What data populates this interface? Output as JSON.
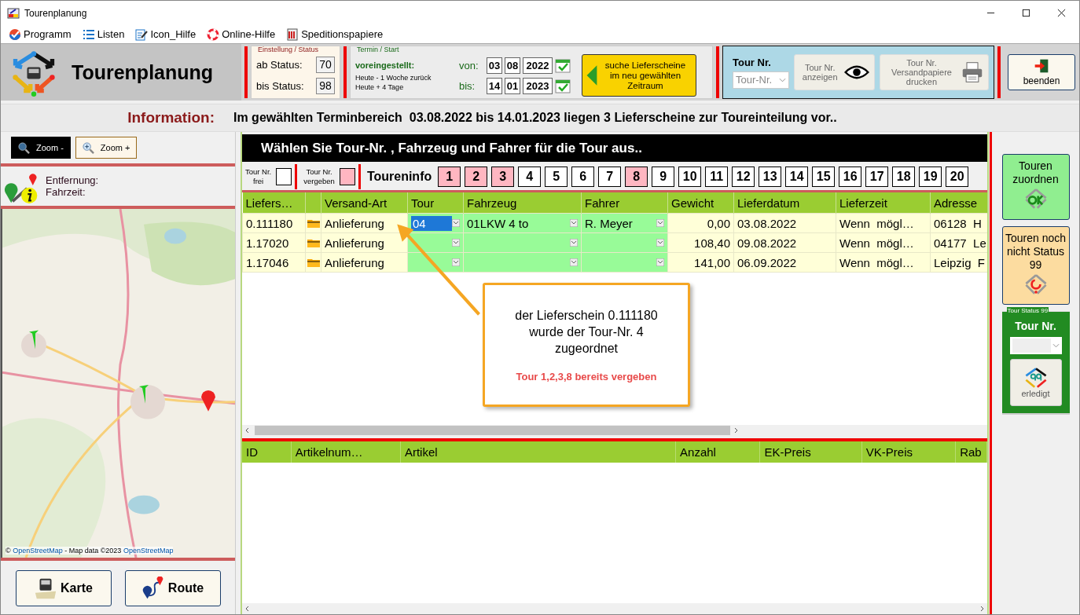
{
  "window": {
    "title": "Tourenplanung"
  },
  "menu": [
    {
      "label": "Programm"
    },
    {
      "label": "Listen"
    },
    {
      "label": "Icon_Hilfe"
    },
    {
      "label": "Online-Hilfe"
    },
    {
      "label": "Speditionspapiere"
    }
  ],
  "header": {
    "title": "Tourenplanung",
    "status": {
      "legend": "Einstellung / Status",
      "from_label": "ab Status:",
      "from_value": "70",
      "to_label": "bis Status:",
      "to_value": "98"
    },
    "termin": {
      "legend": "Termin / Start",
      "preset_label": "voreingestellt:",
      "preset_from": "Heute - 1 Woche zurück",
      "preset_to": "Heute + 4 Tage",
      "rows": [
        {
          "label": "von:",
          "day": "03",
          "month": "08",
          "year": "2022"
        },
        {
          "label": "bis:",
          "day": "14",
          "month": "01",
          "year": "2023"
        }
      ]
    },
    "search_button": [
      "suche Lieferscheine",
      "im neu gewählten",
      "Zeitraum"
    ],
    "tour_panel": {
      "label": "Tour Nr.",
      "select_placeholder": "Tour-Nr.",
      "show_button": [
        "Tour Nr.",
        "anzeigen"
      ],
      "print_button": [
        "Tour Nr.",
        "Versandpapiere",
        "drucken"
      ]
    },
    "exit_button": "beenden"
  },
  "info": {
    "label": "Information:",
    "message": "Im gewählten Terminbereich  03.08.2022 bis 14.01.2023 liegen 3 Lieferscheine zur Toureinteilung vor.."
  },
  "left": {
    "zoom_out": "Zoom -",
    "zoom_in": "Zoom +",
    "distance_label": "Entfernung:",
    "time_label": "Fahrzeit:",
    "map": {
      "attribution_prefix": "©",
      "attribution_link": "OpenStreetMap",
      "attribution_middle": "- Map data ©2023",
      "attribution_link_2": "OpenStreetMap"
    },
    "buttons": [
      "Karte",
      "Route"
    ]
  },
  "main": {
    "heading": "Wählen Sie Tour-Nr. , Fahrzeug und Fahrer für die Tour aus..",
    "legend": [
      {
        "label": [
          "Tour Nr.",
          "frei"
        ],
        "assigned": false
      },
      {
        "label": [
          "Tour Nr.",
          "vergeben"
        ],
        "assigned": true
      }
    ],
    "tourinfo_label": "Toureninfo",
    "tours": [
      {
        "number": "1",
        "assigned": true
      },
      {
        "number": "2",
        "assigned": true
      },
      {
        "number": "3",
        "assigned": true
      },
      {
        "number": "4",
        "assigned": false
      },
      {
        "number": "5",
        "assigned": false
      },
      {
        "number": "6",
        "assigned": false
      },
      {
        "number": "7",
        "assigned": false
      },
      {
        "number": "8",
        "assigned": true
      },
      {
        "number": "9",
        "assigned": false
      },
      {
        "number": "10",
        "assigned": false
      },
      {
        "number": "11",
        "assigned": false
      },
      {
        "number": "12",
        "assigned": false
      },
      {
        "number": "13",
        "assigned": false
      },
      {
        "number": "14",
        "assigned": false
      },
      {
        "number": "15",
        "assigned": false
      },
      {
        "number": "16",
        "assigned": false
      },
      {
        "number": "17",
        "assigned": false
      },
      {
        "number": "18",
        "assigned": false
      },
      {
        "number": "19",
        "assigned": false
      },
      {
        "number": "20",
        "assigned": false
      }
    ],
    "table": {
      "columns": [
        "Liefers…",
        "Versand-Art",
        "Tour",
        "Fahrzeug",
        "Fahrer",
        "Gewicht",
        "Lieferdatum",
        "Lieferzeit",
        "Adresse"
      ],
      "rows": [
        {
          "lieferschein": "0.111180",
          "versand_art": "Anlieferung",
          "tour": "04",
          "tour_selected": true,
          "fahrzeug": "01LKW 4 to",
          "fahrer": "R. Meyer",
          "gewicht": "0,00",
          "lieferdatum": "03.08.2022",
          "lieferzeit": "Wenn  mögl…",
          "adresse": "06128  H"
        },
        {
          "lieferschein": "1.17020",
          "versand_art": "Anlieferung",
          "tour_selected": false,
          "gewicht": "108,40",
          "lieferdatum": "09.08.2022",
          "lieferzeit": "Wenn  mögl…",
          "adresse": "04177  Le"
        },
        {
          "lieferschein": "1.17046",
          "versand_art": "Anlieferung",
          "tour_selected": false,
          "gewicht": "141,00",
          "lieferdatum": "06.09.2022",
          "lieferzeit": "Wenn  mögl…",
          "adresse": "Leipzig  F"
        }
      ]
    },
    "callout": {
      "text": "der Lieferschein 0.111180 wurde der Tour-Nr. 4 zugeordnet",
      "note": "Tour 1,2,3,8 bereits vergeben"
    },
    "detail_table": {
      "columns": [
        "ID",
        "Artikelnum…",
        "Artikel",
        "Anzahl",
        "EK-Preis",
        "VK-Preis",
        "Rab"
      ]
    }
  },
  "right": {
    "assign_button": "Touren zuordnen",
    "pending_button": "Touren noch nicht Status 99",
    "status_group": {
      "legend": "Tour Status 99",
      "label": "Tour Nr.",
      "done_button": "erledigt"
    }
  }
}
